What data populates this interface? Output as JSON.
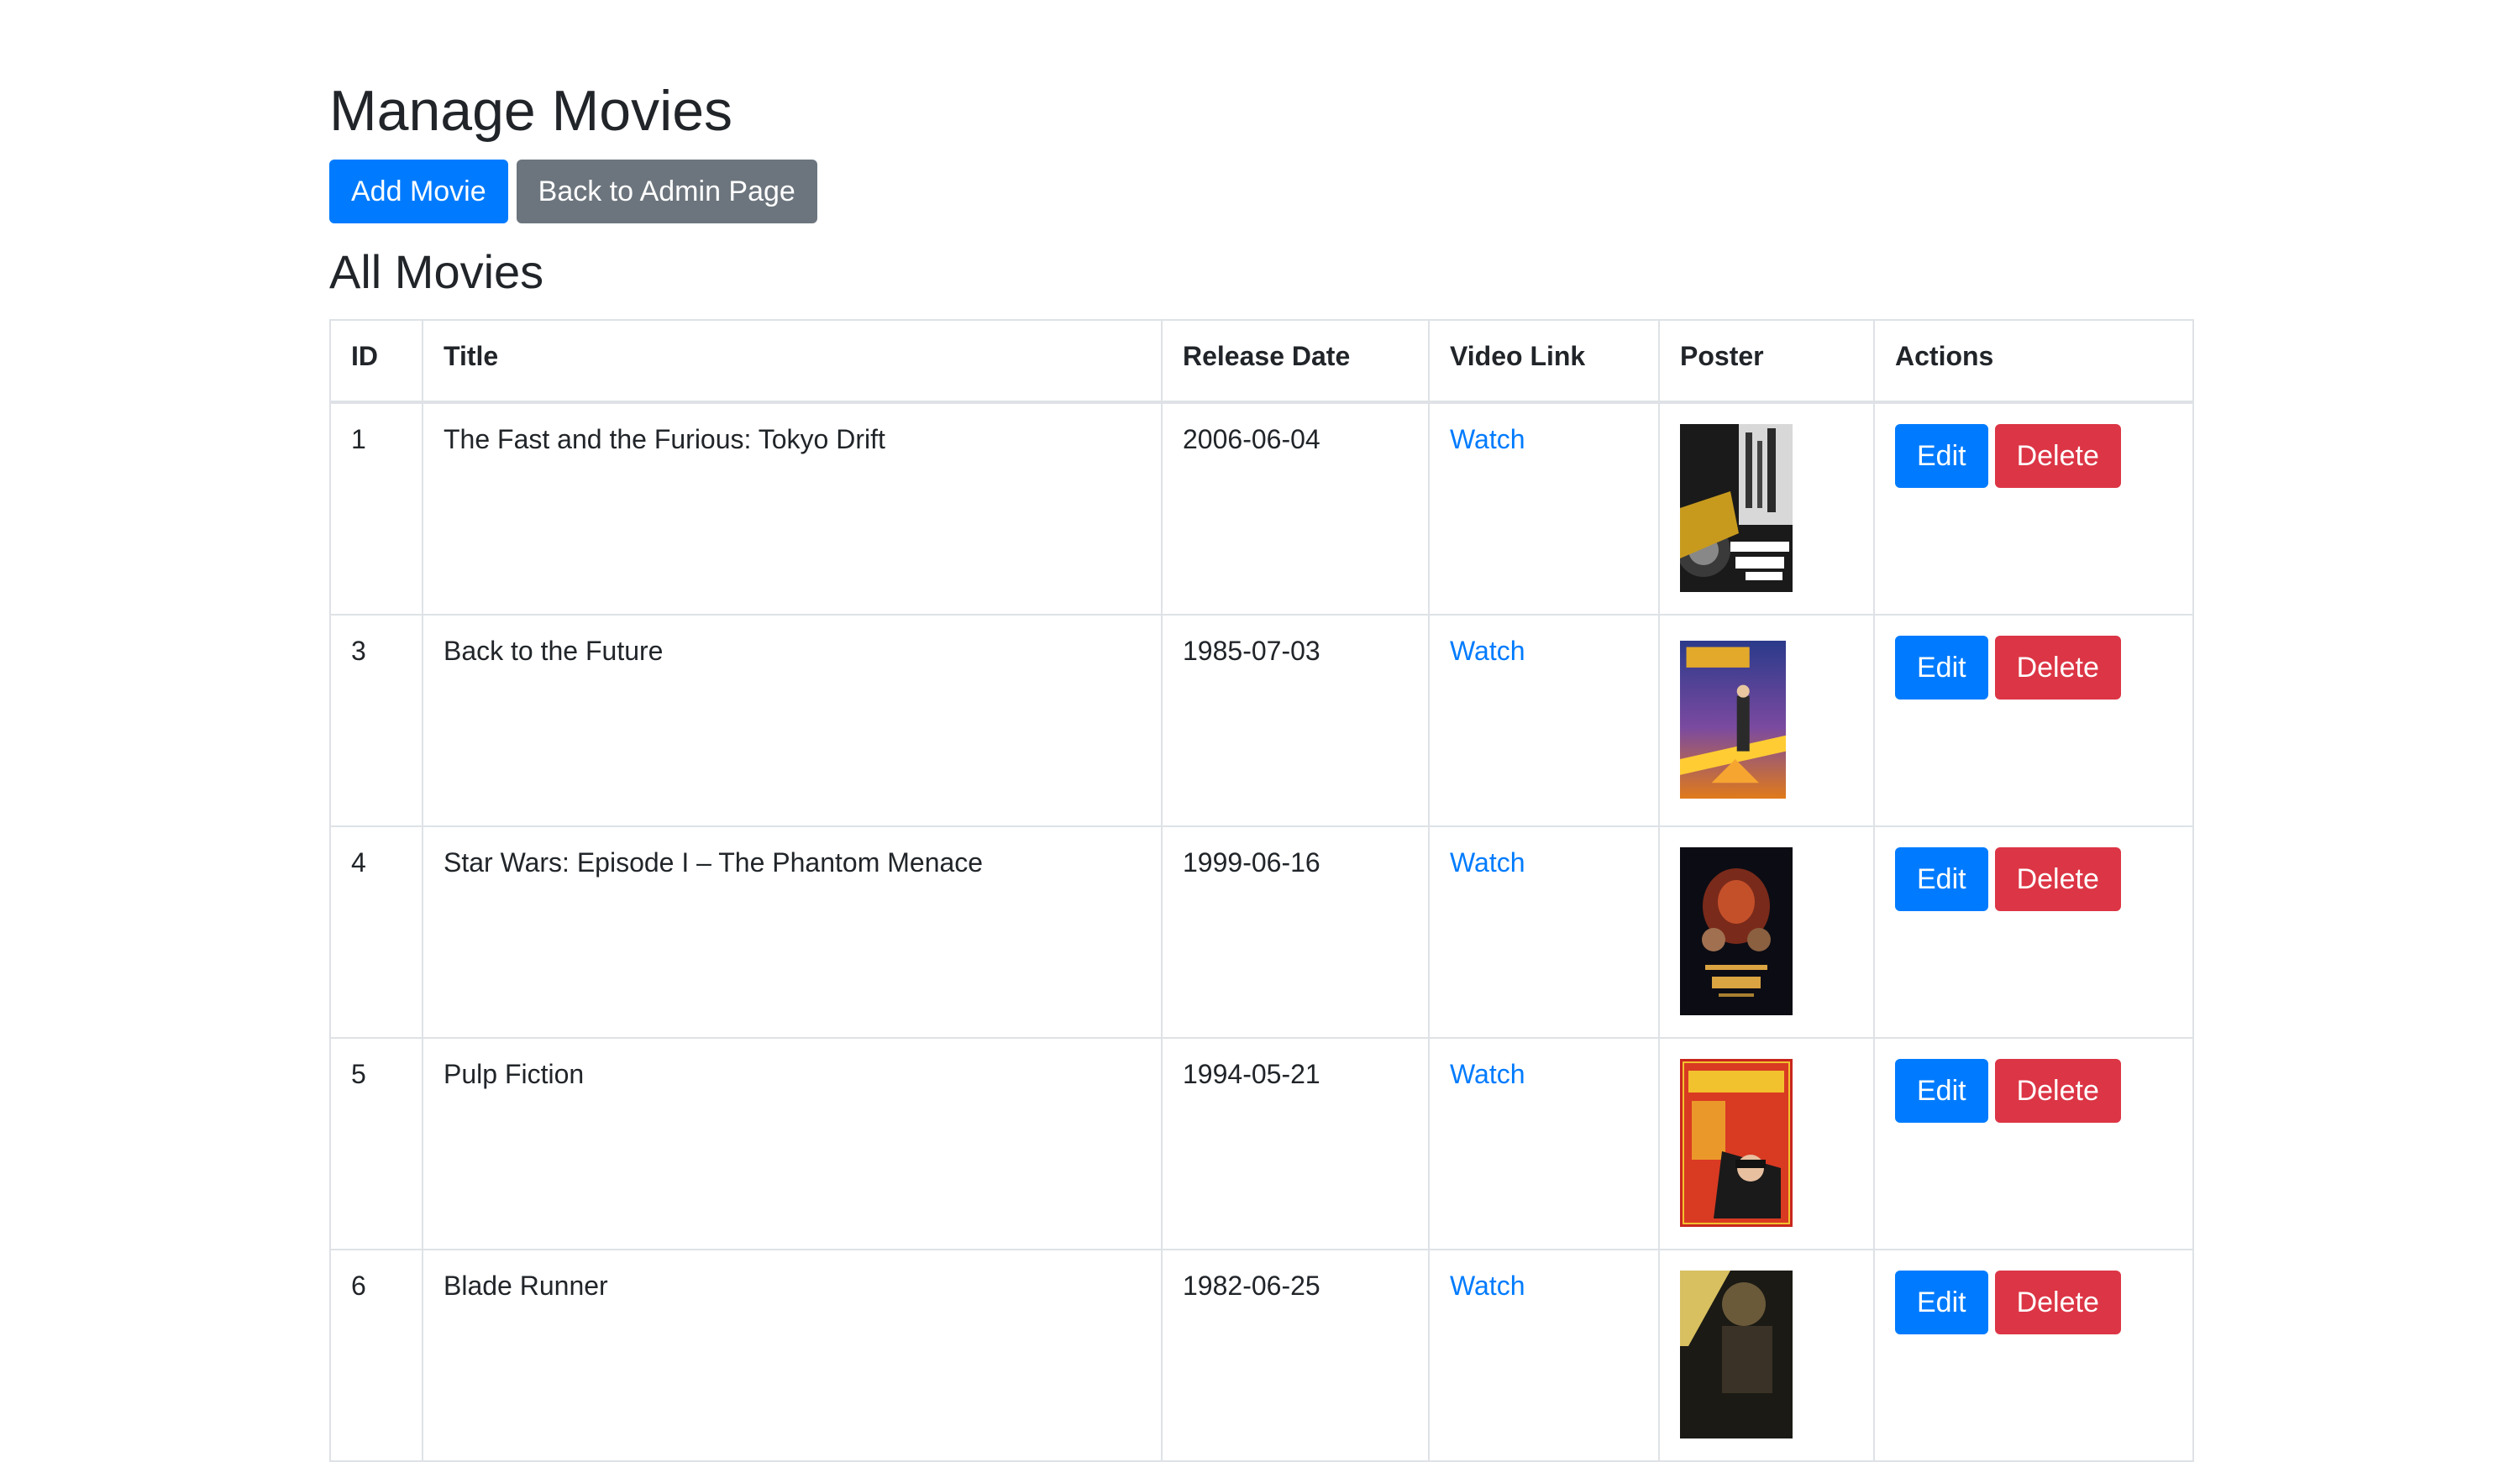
{
  "page": {
    "title": "Manage Movies",
    "add_button": "Add Movie",
    "back_button": "Back to Admin Page",
    "section_title": "All Movies"
  },
  "table": {
    "headers": [
      "ID",
      "Title",
      "Release Date",
      "Video Link",
      "Poster",
      "Actions"
    ],
    "rows": [
      {
        "id": "1",
        "title": "The Fast and the Furious: Tokyo Drift",
        "release_date": "2006-06-04",
        "video_link": "Watch",
        "edit": "Edit",
        "delete": "Delete"
      },
      {
        "id": "3",
        "title": "Back to the Future",
        "release_date": "1985-07-03",
        "video_link": "Watch",
        "edit": "Edit",
        "delete": "Delete"
      },
      {
        "id": "4",
        "title": "Star Wars: Episode I – The Phantom Menace",
        "release_date": "1999-06-16",
        "video_link": "Watch",
        "edit": "Edit",
        "delete": "Delete"
      },
      {
        "id": "5",
        "title": "Pulp Fiction",
        "release_date": "1994-05-21",
        "video_link": "Watch",
        "edit": "Edit",
        "delete": "Delete"
      },
      {
        "id": "6",
        "title": "Blade Runner",
        "release_date": "1982-06-25",
        "video_link": "Watch",
        "edit": "Edit",
        "delete": "Delete"
      }
    ]
  },
  "colors": {
    "primary": "#007bff",
    "secondary": "#6c757d",
    "danger": "#dc3545",
    "border": "#dee2e6",
    "text": "#212529"
  }
}
